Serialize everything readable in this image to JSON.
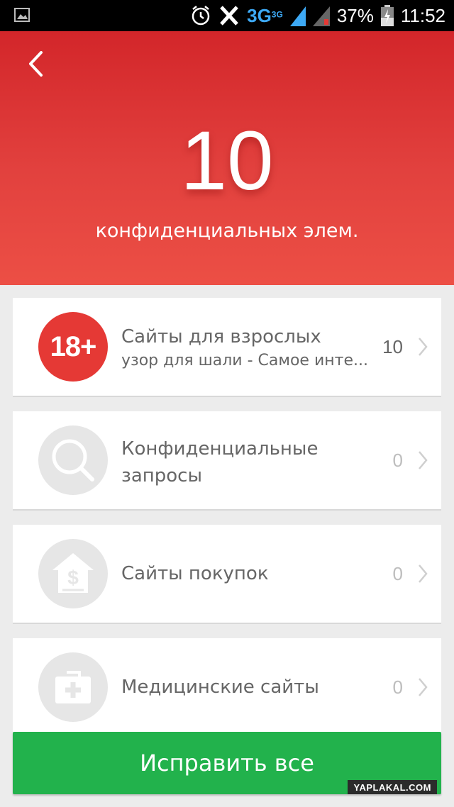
{
  "status_bar": {
    "network": "3G",
    "network_small": "3G",
    "battery": "37%",
    "time": "11:52",
    "icons": [
      "image-notification-icon",
      "alarm-icon",
      "x-app-icon",
      "signal-icon",
      "signal-2-icon",
      "battery-icon"
    ]
  },
  "header": {
    "count": "10",
    "subtitle": "конфиденциальных элем."
  },
  "items": [
    {
      "title": "Сайты для взрослых",
      "subtitle": "узор для шали - Самое инте...",
      "count": "10",
      "icon": "adult-icon",
      "icon_text": "18+"
    },
    {
      "title_line1": "Конфиденциальные",
      "title_line2": "запросы",
      "count": "0",
      "icon": "search-icon"
    },
    {
      "title": "Сайты покупок",
      "count": "0",
      "icon": "shopping-icon"
    },
    {
      "title": "Медицинские сайты",
      "count": "0",
      "icon": "medical-icon"
    }
  ],
  "fix_button": {
    "label": "Исправить все"
  },
  "watermark": "YAPLAKAL.COM",
  "colors": {
    "header_red": "#d3262a",
    "accent_green": "#22b24c",
    "adult_red": "#e53935"
  }
}
